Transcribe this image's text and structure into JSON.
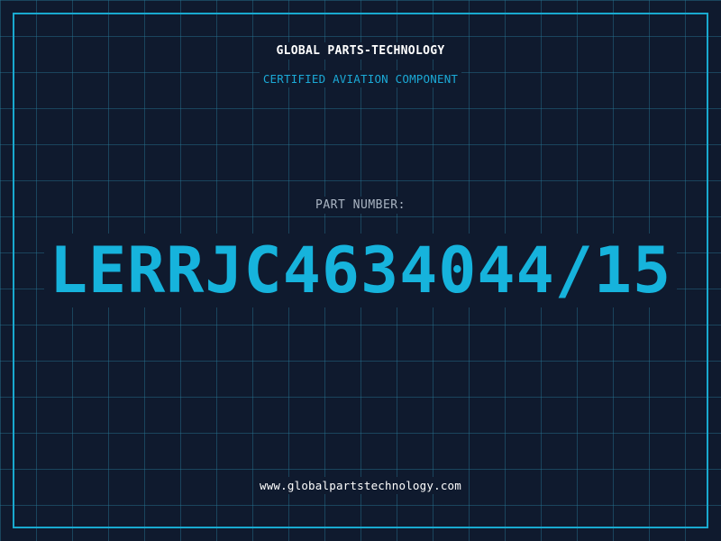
{
  "header": {
    "company_name": "GLOBAL PARTS-TECHNOLOGY",
    "tagline": "CERTIFIED AVIATION COMPONENT"
  },
  "part": {
    "label": "PART NUMBER:",
    "number": "LERRJC4634044/15"
  },
  "footer": {
    "website": "www.globalpartstechnology.com"
  },
  "colors": {
    "background": "#0f1a2e",
    "grid": "#28789a",
    "accent": "#16b3dc",
    "frame": "#19a9cf",
    "label": "#a9b4c2",
    "text": "#ffffff"
  }
}
